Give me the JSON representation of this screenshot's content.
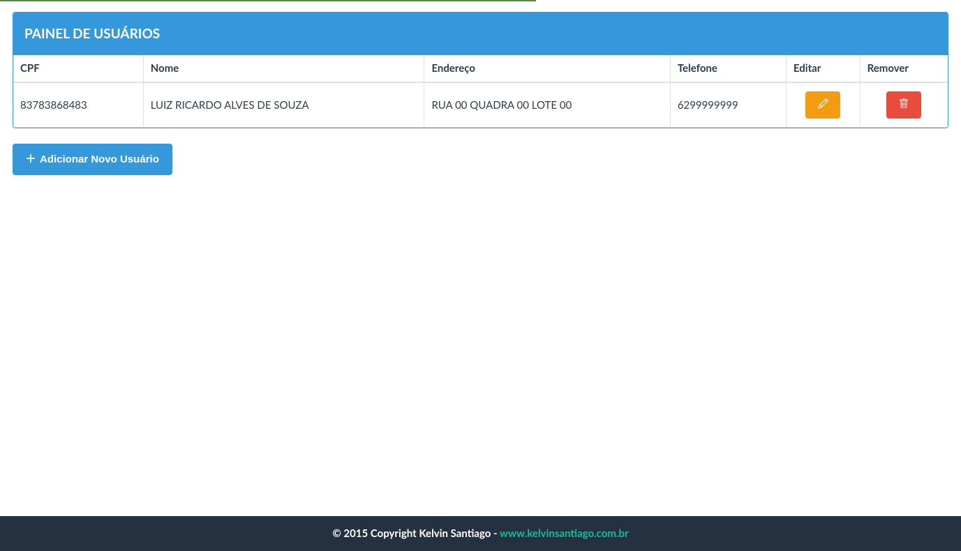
{
  "panel": {
    "title": "PAINEL DE USUÁRIOS"
  },
  "table": {
    "headers": {
      "cpf": "CPF",
      "nome": "Nome",
      "endereco": "Endereço",
      "telefone": "Telefone",
      "editar": "Editar",
      "remover": "Remover"
    },
    "rows": [
      {
        "cpf": "83783868483",
        "nome": "LUIZ RICARDO ALVES DE SOUZA",
        "endereco": "RUA 00 QUADRA 00 LOTE 00",
        "telefone": "6299999999"
      }
    ]
  },
  "actions": {
    "add_user": "Adicionar Novo Usuário"
  },
  "footer": {
    "copyright": "© 2015 Copyright Kelvin Santiago - ",
    "link_text": "www.kelvinsantiago.com.br"
  }
}
